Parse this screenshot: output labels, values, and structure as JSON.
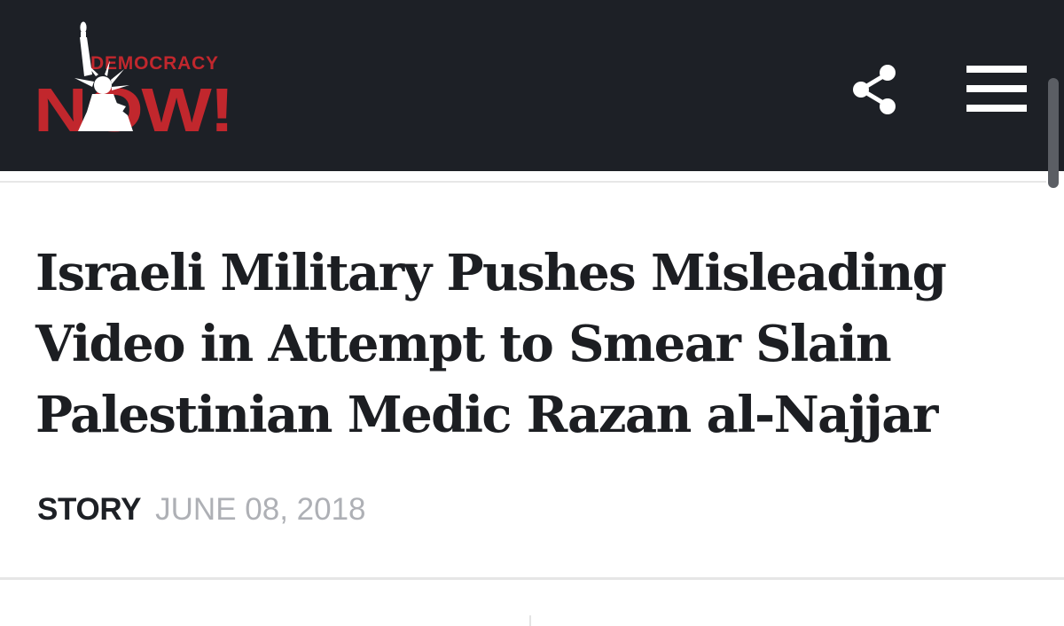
{
  "header": {
    "logo": {
      "top_text": "DEMOCRACY",
      "main_text": "NOW!",
      "alt": "Democracy Now!"
    },
    "share_icon": "share-icon",
    "menu_icon": "hamburger-menu-icon",
    "background_color": "#1d2026",
    "brand_color": "#c1272d"
  },
  "article": {
    "headline": "Israeli Military Pushes Misleading Video in Attempt to Smear Slain Palestinian Medic Razan al-Najjar",
    "category": "STORY",
    "date": "JUNE 08, 2018"
  }
}
